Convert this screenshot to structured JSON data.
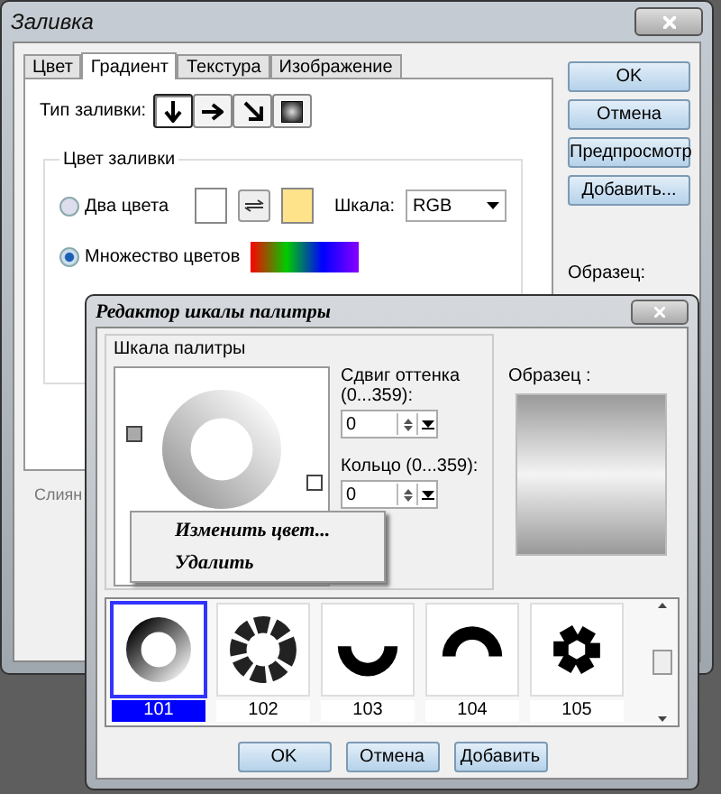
{
  "main_window": {
    "title": "Заливка",
    "tabs": [
      {
        "label": "Цвет",
        "selected": false
      },
      {
        "label": "Градиент",
        "selected": true
      },
      {
        "label": "Текстура",
        "selected": false
      },
      {
        "label": "Изображение",
        "selected": false
      }
    ],
    "fill_type": {
      "label": "Тип заливки:",
      "options": [
        {
          "kind": "down",
          "selected": true
        },
        {
          "kind": "right",
          "selected": false
        },
        {
          "kind": "diagonal",
          "selected": false
        },
        {
          "kind": "square",
          "selected": false
        }
      ]
    },
    "fill_color": {
      "title": "Цвет заливки",
      "two_colors": {
        "label": "Два цвета",
        "selected": false,
        "swatches": [
          {
            "color": "#ffffff"
          },
          {
            "color": "#ffe38a"
          }
        ]
      },
      "scale": {
        "label": "Шкала:",
        "value": "RGB"
      },
      "many_colors": {
        "label": "Множество цветов",
        "selected": true
      }
    },
    "blend_label": "Слиян",
    "buttons": [
      "OK",
      "Отмена",
      "Предпросмотр",
      "Добавить..."
    ],
    "sample_label": "Образец:"
  },
  "palette_editor": {
    "title": "Редактор шкалы палитры",
    "group_title": "Шкала палитры",
    "hue_shift": {
      "label": "Сдвиг оттенка (0...359):",
      "value": "0"
    },
    "ring": {
      "label": "Кольцо (0...359):",
      "value": "0"
    },
    "sample_label": "Образец :",
    "presets": [
      {
        "label": "101",
        "kind": "ring",
        "selected": true
      },
      {
        "label": "102",
        "kind": "dotted-ring",
        "selected": false
      },
      {
        "label": "103",
        "kind": "bowl",
        "selected": false
      },
      {
        "label": "104",
        "kind": "arch",
        "selected": false
      },
      {
        "label": "105",
        "kind": "segments",
        "selected": false
      }
    ],
    "buttons": [
      "OK",
      "Отмена",
      "Добавить"
    ]
  },
  "context_menu": {
    "items": [
      "Изменить цвет...",
      "Удалить"
    ]
  }
}
